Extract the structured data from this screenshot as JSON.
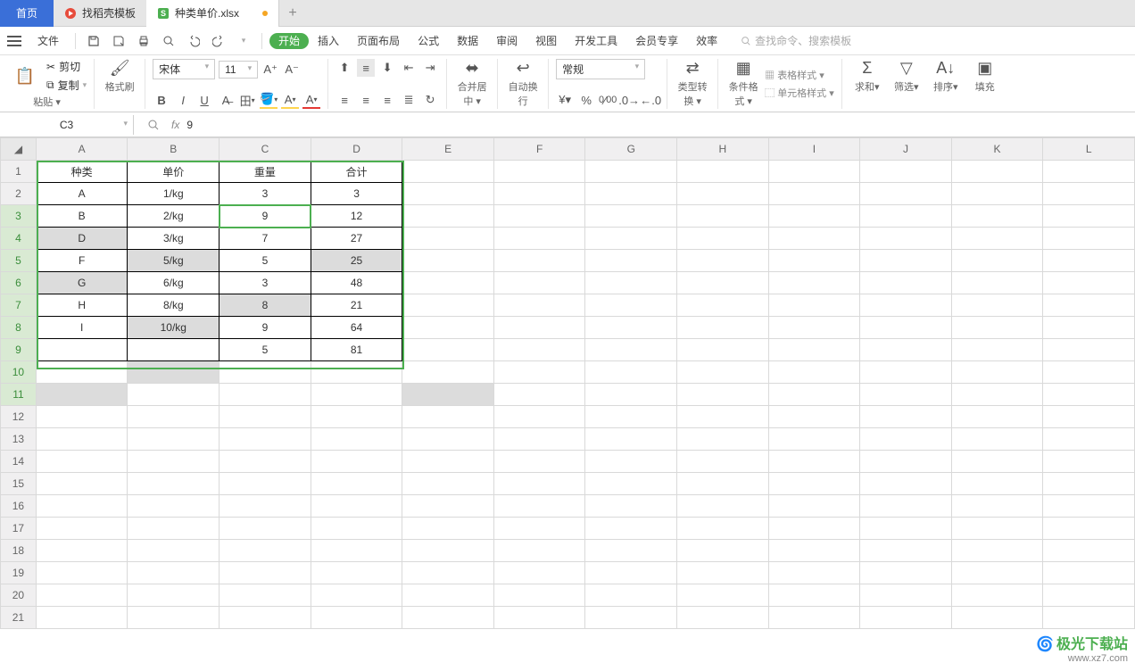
{
  "tabs": {
    "home": "首页",
    "template": "找稻壳模板",
    "doc": "种类单价.xlsx"
  },
  "menu": {
    "file": "文件",
    "items": [
      "开始",
      "插入",
      "页面布局",
      "公式",
      "数据",
      "审阅",
      "视图",
      "开发工具",
      "会员专享",
      "效率"
    ],
    "search_placeholder": "查找命令、搜索模板"
  },
  "ribbon": {
    "paste": "粘贴",
    "cut": "剪切",
    "copy": "复制",
    "format_painter": "格式刷",
    "font_name": "宋体",
    "font_size": "11",
    "merge": "合并居中",
    "wrap": "自动换行",
    "number_format": "常规",
    "type_convert": "类型转换",
    "cond_format": "条件格式",
    "table_style": "表格样式",
    "cell_style": "单元格样式",
    "sum": "求和",
    "filter": "筛选",
    "sort": "排序",
    "fill": "填充"
  },
  "namebox": {
    "ref": "C3",
    "formula": "9"
  },
  "columns": [
    "A",
    "B",
    "C",
    "D",
    "E",
    "F",
    "G",
    "H",
    "I",
    "J",
    "K",
    "L"
  ],
  "rows_count": 21,
  "headers": {
    "A": "种类",
    "B": "单价",
    "C": "重量",
    "D": "合计"
  },
  "data": [
    {
      "A": "A",
      "B": "1/kg",
      "C": "3",
      "D": "3"
    },
    {
      "A": "B",
      "B": "2/kg",
      "C": "9",
      "D": "12"
    },
    {
      "A": "D",
      "B": "3/kg",
      "C": "7",
      "D": "27"
    },
    {
      "A": "F",
      "B": "5/kg",
      "C": "5",
      "D": "25"
    },
    {
      "A": "G",
      "B": "6/kg",
      "C": "3",
      "D": "48"
    },
    {
      "A": "H",
      "B": "8/kg",
      "C": "8",
      "D": "21"
    },
    {
      "A": "I",
      "B": "10/kg",
      "C": "9",
      "D": "64"
    },
    {
      "A": "",
      "B": "",
      "C": "5",
      "D": "81"
    }
  ],
  "shaded_cells": [
    "A4",
    "B5",
    "D5",
    "A6",
    "C7",
    "B8",
    "B10",
    "A11",
    "E11"
  ],
  "selected_row_headers": [
    3,
    4,
    5,
    6,
    7,
    8,
    9,
    10,
    11
  ],
  "active_cell": "C3",
  "selection_range": "A1:D9",
  "watermark": {
    "brand": "极光下载站",
    "url": "www.xz7.com"
  }
}
